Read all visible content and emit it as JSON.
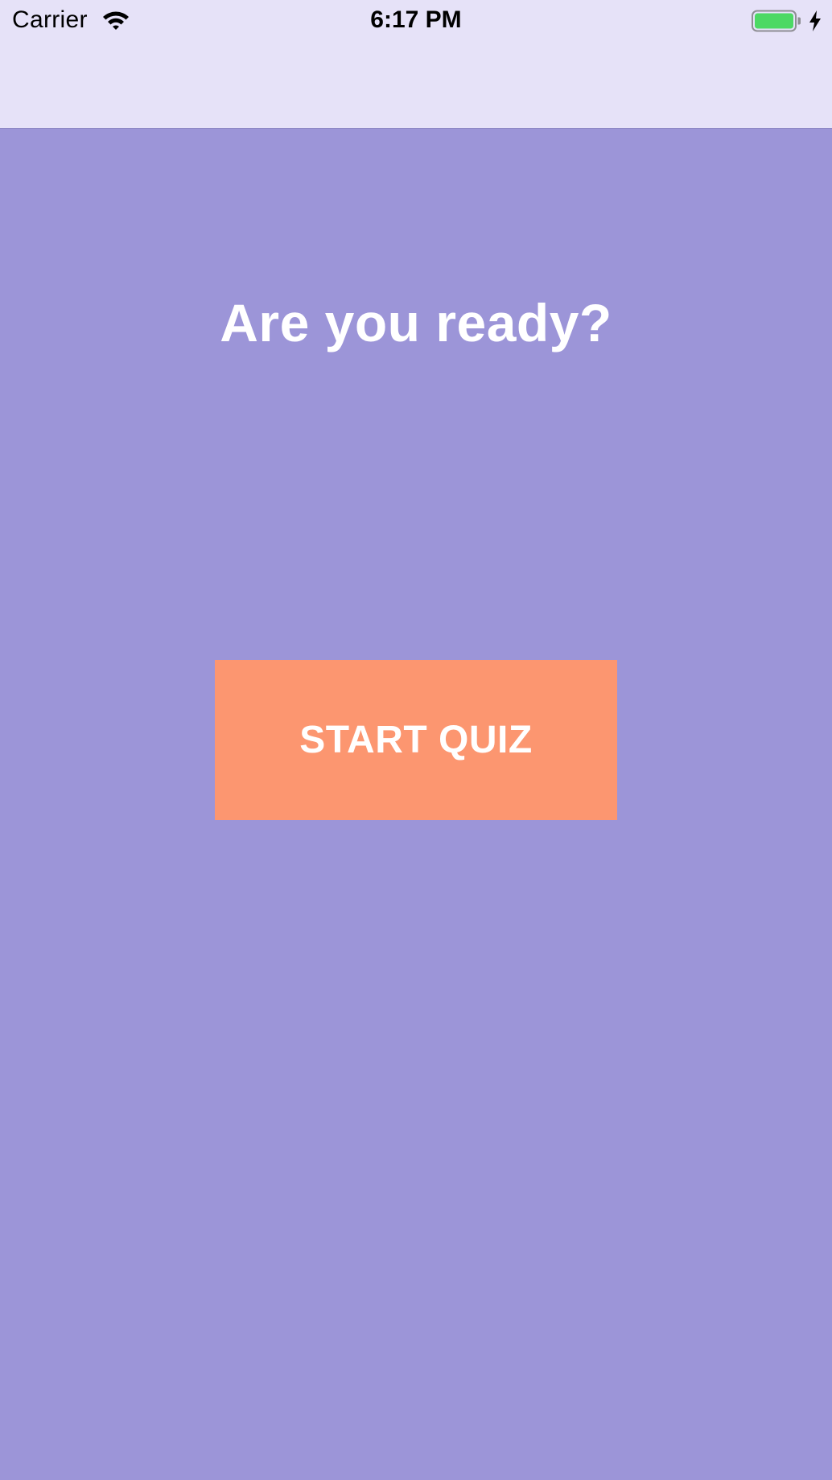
{
  "status_bar": {
    "carrier": "Carrier",
    "time": "6:17 PM",
    "wifi_icon": "wifi-icon",
    "battery_icon": "battery-charging-icon",
    "battery_level": 1.0
  },
  "main": {
    "headline": "Are you ready?",
    "start_button_label": "START QUIZ"
  },
  "colors": {
    "background": "#9c95d8",
    "nav_bar": "#e6e2f8",
    "button": "#fc9670",
    "text_light": "#ffffff",
    "battery_fill": "#4cd964"
  }
}
